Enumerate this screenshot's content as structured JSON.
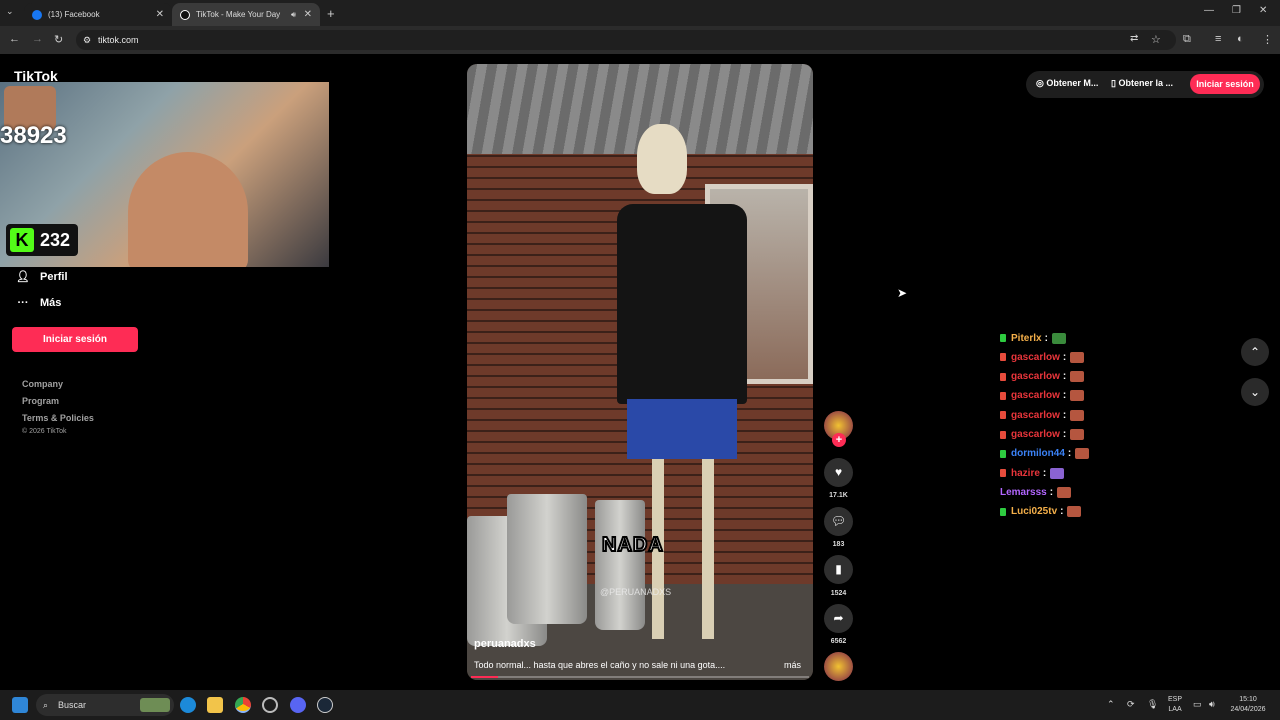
{
  "browser": {
    "tabs": [
      {
        "label": "(13) Facebook",
        "favicon_color": "#1877f2"
      },
      {
        "label": "TikTok - Make Your Day",
        "favicon_color": "#111111"
      }
    ],
    "url": "tiktok.com"
  },
  "sidebar": {
    "logo": "TikTok",
    "stream_count": "38923",
    "kick_viewers": "232",
    "items": [
      {
        "label": "Perfil",
        "icon": "person-icon"
      },
      {
        "label": "Más",
        "icon": "more-icon"
      }
    ],
    "login_label": "Iniciar sesión",
    "footer": [
      "Company",
      "Program",
      "Terms & Policies"
    ],
    "copyright": "© 2026 TikTok"
  },
  "video": {
    "author": "peruanadxs",
    "description": "Todo normal... hasta que abres el caño y no sale ni una gota....",
    "more": "más",
    "overlay_text": "NADA",
    "watermark": "@PERUANADXS",
    "progress": 0.08
  },
  "actions": {
    "likes": "17.1K",
    "comments": "183",
    "saves": "1524",
    "shares": "6562"
  },
  "topbar": {
    "btn1": "Obtener M...",
    "btn2": "Obtener la ...",
    "login": "Iniciar sesión"
  },
  "chat": [
    {
      "user": "Piterlx",
      "color": "#f5b04a",
      "badge": "green",
      "emote": "green"
    },
    {
      "user": "gascarlow",
      "color": "#e8353b",
      "badge": "red",
      "emote": "brick"
    },
    {
      "user": "gascarlow",
      "color": "#e8353b",
      "badge": "red",
      "emote": "brick"
    },
    {
      "user": "gascarlow",
      "color": "#e8353b",
      "badge": "red",
      "emote": "brick"
    },
    {
      "user": "gascarlow",
      "color": "#e8353b",
      "badge": "red",
      "emote": "brick"
    },
    {
      "user": "gascarlow",
      "color": "#e8353b",
      "badge": "red",
      "emote": "brick"
    },
    {
      "user": "dormilon44",
      "color": "#3b82f6",
      "badge": "green",
      "emote": "brick"
    },
    {
      "user": "hazire",
      "color": "#e8353b",
      "badge": "red",
      "emote": "purple"
    },
    {
      "user": "Lemarsss",
      "color": "#b266ff",
      "badge": "none",
      "emote": "brick"
    },
    {
      "user": "Luci025tv",
      "color": "#f5b04a",
      "badge": "green",
      "emote": "brick"
    }
  ],
  "taskbar": {
    "search": "Buscar",
    "lang": "ESP",
    "lang2": "LAA",
    "time": "15:10",
    "date": "24/04/2026"
  },
  "colors": {
    "accent": "#fe2c55",
    "kick": "#53fc18"
  }
}
